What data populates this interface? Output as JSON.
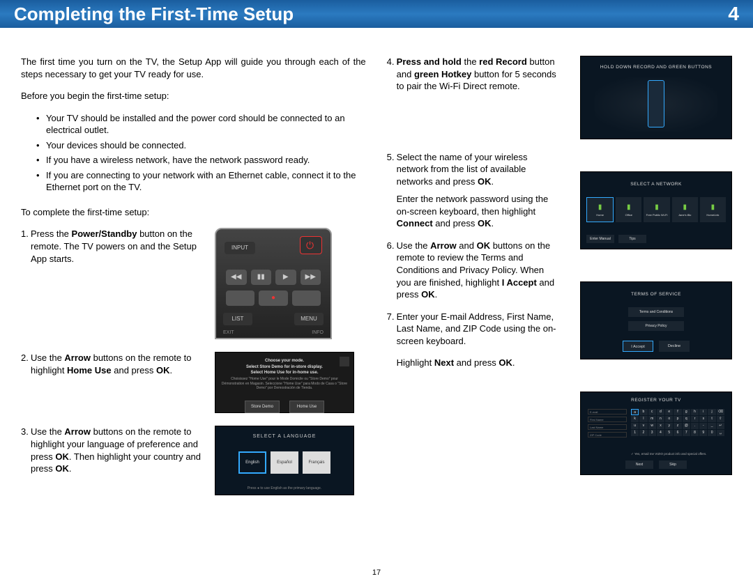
{
  "header": {
    "title": "Completing the First-Time Setup",
    "chapter": "4"
  },
  "intro": "The first time you turn on the TV, the Setup App will guide you through each of the steps necessary to get your TV ready for use.",
  "before_label": "Before you begin the first-time setup:",
  "before_items": [
    "Your TV should be installed and the power cord should be connected to an electrical outlet.",
    "Your devices should be connected.",
    "If you have a wireless network, have the network password ready.",
    "If you are connecting to your network with an Ethernet cable, connect it to the Ethernet port on the TV."
  ],
  "complete_label": "To complete the first-time setup:",
  "steps": {
    "s1": {
      "n": "1.",
      "a": "Press the ",
      "b": "Power/Standby",
      "c": " button on the remote. The TV powers on and the Setup App starts."
    },
    "s2": {
      "n": "2.",
      "a": "Use the ",
      "b": "Arrow",
      "c": " buttons on the remote to highlight ",
      "d": "Home Use",
      "e": " and press ",
      "f": "OK",
      "g": "."
    },
    "s3": {
      "n": "3.",
      "a": "Use the ",
      "b": "Arrow",
      "c": " buttons on the remote to highlight your language of preference and press ",
      "d": "OK",
      "e": ". Then highlight your country and press ",
      "f": "OK",
      "g": "."
    },
    "s4": {
      "n": "4.",
      "a": "Press and hold",
      "b": " the ",
      "c": "red Record",
      "d": " button and ",
      "e": "green Hotkey",
      "f": " button for 5 seconds to pair the Wi-Fi Direct remote."
    },
    "s5": {
      "n": "5.",
      "a": "Select the name of your wireless network from the list of available networks and press ",
      "b": "OK",
      "c": ".",
      "p2a": "Enter the network password using the on-screen keyboard, then highlight ",
      "p2b": "Connect",
      "p2c": " and press ",
      "p2d": "OK",
      "p2e": "."
    },
    "s6": {
      "n": "6.",
      "a": "Use the ",
      "b": "Arrow",
      "c": " and ",
      "d": "OK",
      "e": " buttons on the remote to review the Terms and Conditions and Privacy Policy. When you are finished, highlight ",
      "f": "I Accept",
      "g": " and press ",
      "h": "OK",
      "i": "."
    },
    "s7": {
      "n": "7.",
      "a": "Enter your E-mail Address, First Name, Last Name, and ZIP Code using the on-screen keyboard.",
      "p2a": "Highlight ",
      "p2b": "Next",
      "p2c": " and press ",
      "p2d": "OK",
      "p2e": "."
    }
  },
  "screens": {
    "remote": {
      "input": "INPUT",
      "list": "LIST",
      "menu": "MENU",
      "exit": "EXIT",
      "info": "INFO"
    },
    "mode": {
      "t1": "Choose your mode.",
      "t2": "Select Store Demo for in-store display.",
      "t3": "Select Home Use for in-home use.",
      "sub": "Choisissez \"Home Use\" pour le Mode Domicile ou \"Store Demo\" pour Démonstration en Magasin. Seleccione \"Home Use\" para Modo de Casa o \"Store Demo\" por Demostración de Tienda.",
      "b1": "Store Demo",
      "b2": "Home Use"
    },
    "lang": {
      "ttl": "SELECT A LANGUAGE",
      "o1": "English",
      "o2": "Español",
      "o3": "Français",
      "foot": "Press ● to use English as the primary language."
    },
    "pair": {
      "txt": "HOLD DOWN RECORD AND GREEN BUTTONS"
    },
    "net": {
      "ttl": "SELECT A NETWORK",
      "o1": "Home",
      "o2": "Office",
      "o3": "Free Public Wi-Fi",
      "o4": "Jane's iBo",
      "o5": "HomeLink",
      "f1": "Enter Manual",
      "f2": "Tips"
    },
    "tos": {
      "ttl": "TERMS OF SERVICE",
      "l1": "Terms and Conditions",
      "l2": "Privacy Policy",
      "b1": "I Accept",
      "b2": "Decline"
    },
    "reg": {
      "ttl": "REGISTER YOUR TV",
      "f1": "E-mail",
      "f2": "First Name",
      "f3": "Last Name",
      "f4": "ZIP Code",
      "chk": "Yes, email me VIZIO product info and special offers.",
      "b1": "Next",
      "b2": "Skip"
    }
  },
  "page_number": "17"
}
